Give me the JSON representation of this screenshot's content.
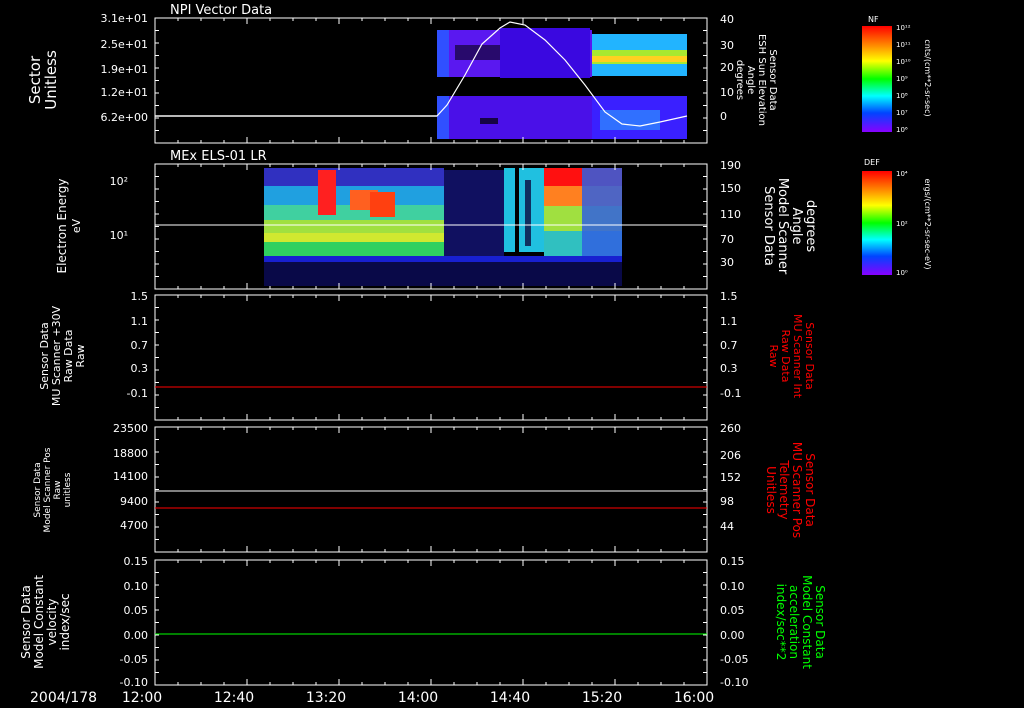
{
  "time_axis": {
    "date_label": "2004/178",
    "ticks": [
      "12:00",
      "12:40",
      "13:20",
      "14:00",
      "14:40",
      "15:20",
      "16:00"
    ]
  },
  "colors": {
    "background": "#000000",
    "axes": "#ffffff",
    "red_trace": "#ff0000",
    "green_trace": "#00ff00"
  },
  "panels": [
    {
      "id": "npi",
      "title": "NPI Vector Data",
      "left_label": [
        "Sector",
        "Unitless"
      ],
      "left_ticks": [
        "3.1e+01",
        "2.5e+01",
        "1.9e+01",
        "1.2e+01",
        "6.2e+00"
      ],
      "right_label": [
        "Sensor Data",
        "ESH Sun Elevation",
        "Angle",
        "degrees"
      ],
      "right_ticks": [
        "40",
        "30",
        "20",
        "10",
        "0"
      ],
      "colorbar": {
        "name": "NF",
        "unit": "cnts/(cm**2-sr-sec)",
        "ticks": [
          "10¹²",
          "10¹¹",
          "10¹⁰",
          "10⁹",
          "10⁸",
          "10⁷",
          "10⁶"
        ]
      }
    },
    {
      "id": "els",
      "title": "MEx ELS-01 LR",
      "left_label": [
        "Electron Energy",
        "eV"
      ],
      "left_ticks": [
        "10²",
        "10¹"
      ],
      "right_label": [
        "Sensor Data",
        "Model Scanner",
        "Angle",
        "degrees"
      ],
      "right_ticks": [
        "190",
        "150",
        "110",
        "70",
        "30"
      ],
      "colorbar": {
        "name": "DEF",
        "unit": "ergs/(cm**2-sr-sec-eV)",
        "ticks": [
          "10⁴",
          "10²",
          "10⁰"
        ]
      }
    },
    {
      "id": "mu_raw",
      "title": "",
      "left_label": [
        "Sensor Data",
        "MU Scanner +30V",
        "Raw Data",
        "Raw"
      ],
      "left_ticks": [
        "1.5",
        "1.1",
        "0.7",
        "0.3",
        "-0.1"
      ],
      "right_label": [
        "Sensor Data",
        "MU Scanner Int",
        "Raw Data",
        "Raw"
      ],
      "right_ticks": [
        "1.5",
        "1.1",
        "0.7",
        "0.3",
        "-0.1"
      ]
    },
    {
      "id": "scanner_pos",
      "title": "",
      "left_label": [
        "Sensor Data",
        "Model Scanner Pos",
        "Raw",
        "unitless"
      ],
      "left_ticks": [
        "23500",
        "18800",
        "14100",
        "9400",
        "4700"
      ],
      "right_label": [
        "Sensor Data",
        "MU Scanner Pos",
        "Telemetry",
        "Unitless"
      ],
      "right_ticks": [
        "260",
        "206",
        "152",
        "98",
        "44"
      ]
    },
    {
      "id": "model_const",
      "title": "",
      "left_label": [
        "Sensor Data",
        "Model Constant",
        "velocity",
        "index/sec"
      ],
      "left_ticks": [
        "0.15",
        "0.10",
        "0.05",
        "0.00",
        "-0.05",
        "-0.10"
      ],
      "right_label": [
        "Sensor Data",
        "Model Constant",
        "acceleration",
        "index/sec**2"
      ],
      "right_ticks": [
        "0.15",
        "0.10",
        "0.05",
        "0.00",
        "-0.05",
        "-0.10"
      ]
    }
  ],
  "chart_data": [
    {
      "type": "heatmap",
      "title": "NPI Vector Data",
      "xlabel": "",
      "x_range": [
        "12:00",
        "16:00"
      ],
      "ylabel": "Sector Unitless",
      "ylim": [
        0,
        31
      ],
      "data_window": [
        "14:03",
        "15:55"
      ],
      "overlay_line": {
        "name": "Sensor Data ESH Sun Elevation Angle",
        "ylim": [
          -10,
          40
        ],
        "x": [
          "12:00",
          "14:00",
          "14:05",
          "14:15",
          "14:25",
          "14:33",
          "14:40",
          "14:50",
          "15:00",
          "15:10",
          "15:20",
          "15:30",
          "15:40",
          "15:55"
        ],
        "y": [
          0,
          0,
          1,
          14,
          31,
          38,
          37,
          30,
          18,
          6,
          -2,
          -3,
          -2,
          0
        ]
      }
    },
    {
      "type": "heatmap",
      "title": "MEx ELS-01 LR",
      "ylabel": "Electron Energy eV",
      "y_scale": "log",
      "data_window": [
        "12:50",
        "15:22"
      ],
      "overlay_line": {
        "name": "Sensor Data Model Scanner Angle",
        "ylim": [
          10,
          190
        ],
        "x": [
          "12:00",
          "16:00"
        ],
        "y": [
          90,
          90
        ]
      }
    },
    {
      "type": "line",
      "ylim": [
        -0.3,
        1.5
      ],
      "series": [
        {
          "name": "Sensor Data MU Scanner Int Raw Data",
          "x": [
            "12:00",
            "16:00"
          ],
          "y": [
            0.0,
            0.0
          ],
          "color": "#ff0000"
        }
      ]
    },
    {
      "type": "line",
      "ylim": [
        0,
        23500
      ],
      "series": [
        {
          "name": "Sensor Data Model Scanner Pos",
          "x": [
            "12:00",
            "16:00"
          ],
          "y": [
            11700,
            11700
          ],
          "color": "#ffffff"
        },
        {
          "name": "Sensor Data MU Scanner Pos Telemetry",
          "x": [
            "12:00",
            "16:00"
          ],
          "y": [
            108,
            108
          ],
          "y_axis": "right",
          "ylim_right": [
            0,
            260
          ],
          "color": "#ff0000"
        }
      ]
    },
    {
      "type": "line",
      "ylim": [
        -0.1,
        0.15
      ],
      "series": [
        {
          "name": "Sensor Data Model Constant acceleration",
          "x": [
            "12:00",
            "16:00"
          ],
          "y": [
            0.0,
            0.0
          ],
          "color": "#00ff00"
        }
      ]
    }
  ]
}
